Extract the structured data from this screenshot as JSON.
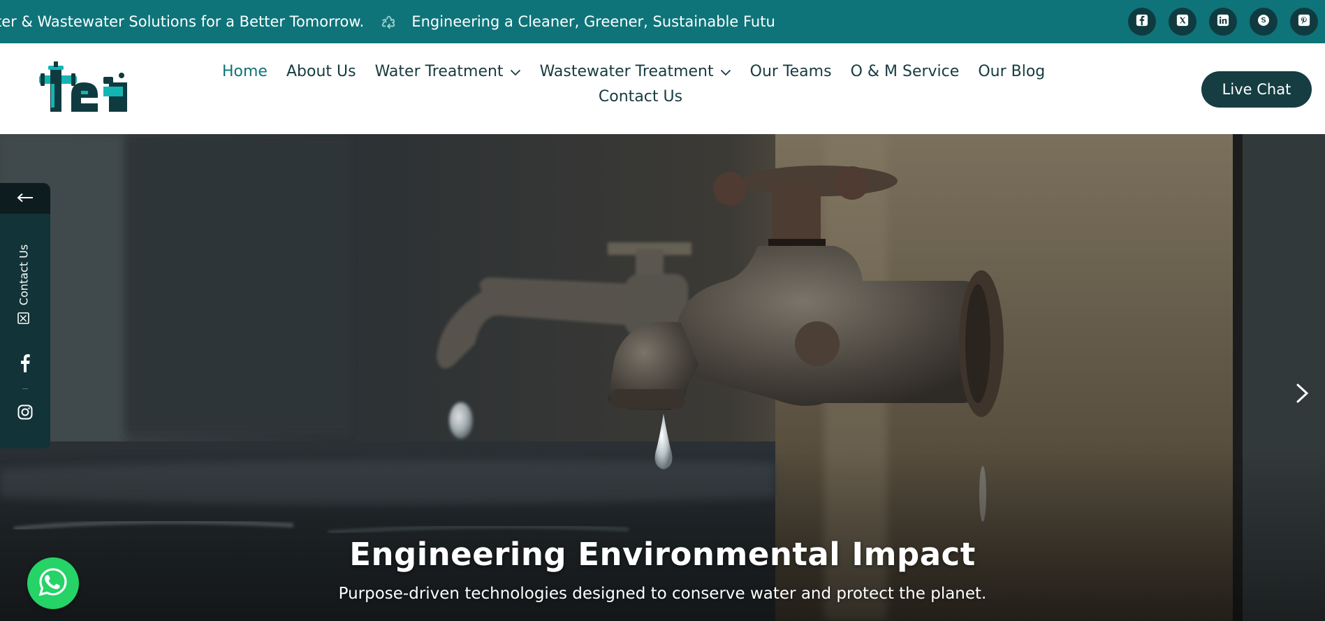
{
  "ticker": {
    "items": [
      "ter & Wastewater Solutions for a Better Tomorrow.",
      "Engineering a Cleaner, Greener, Sustainable Futu"
    ],
    "separator_icon": "recycle-icon"
  },
  "socials": [
    {
      "name": "facebook",
      "icon": "facebook-icon"
    },
    {
      "name": "x",
      "icon": "x-twitter-icon"
    },
    {
      "name": "linkedin",
      "icon": "linkedin-icon"
    },
    {
      "name": "skype",
      "icon": "skype-icon"
    },
    {
      "name": "pinterest",
      "icon": "pinterest-icon"
    }
  ],
  "header": {
    "logo_icon": "tei-logo",
    "nav": {
      "home": "Home",
      "about": "About Us",
      "water": "Water Treatment",
      "wastewater": "Wastewater Treatment",
      "teams": "Our Teams",
      "om": "O & M Service",
      "blog": "Our Blog",
      "contact": "Contact Us"
    },
    "active_item": "Home",
    "cta": "Live Chat"
  },
  "hero": {
    "title": "Engineering Environmental Impact",
    "subtitle": "Purpose-driven technologies designed to conserve water and protect the planet.",
    "next_icon": "chevron-right-icon"
  },
  "side_panel": {
    "toggle_icon": "arrow-left-icon",
    "contact_label": "Contact Us",
    "mail_icon": "mail-icon",
    "links": [
      {
        "name": "facebook",
        "icon": "facebook-icon"
      },
      {
        "name": "instagram",
        "icon": "instagram-icon"
      }
    ]
  },
  "whatsapp": {
    "icon": "whatsapp-icon"
  },
  "colors": {
    "topbar": "#0e7479",
    "social_bg": "#0f3b40",
    "nav_text": "#163b40",
    "nav_active": "#0e7479",
    "cta_bg": "#153d42",
    "side_panel": "#123337",
    "whatsapp": "#25d366"
  }
}
